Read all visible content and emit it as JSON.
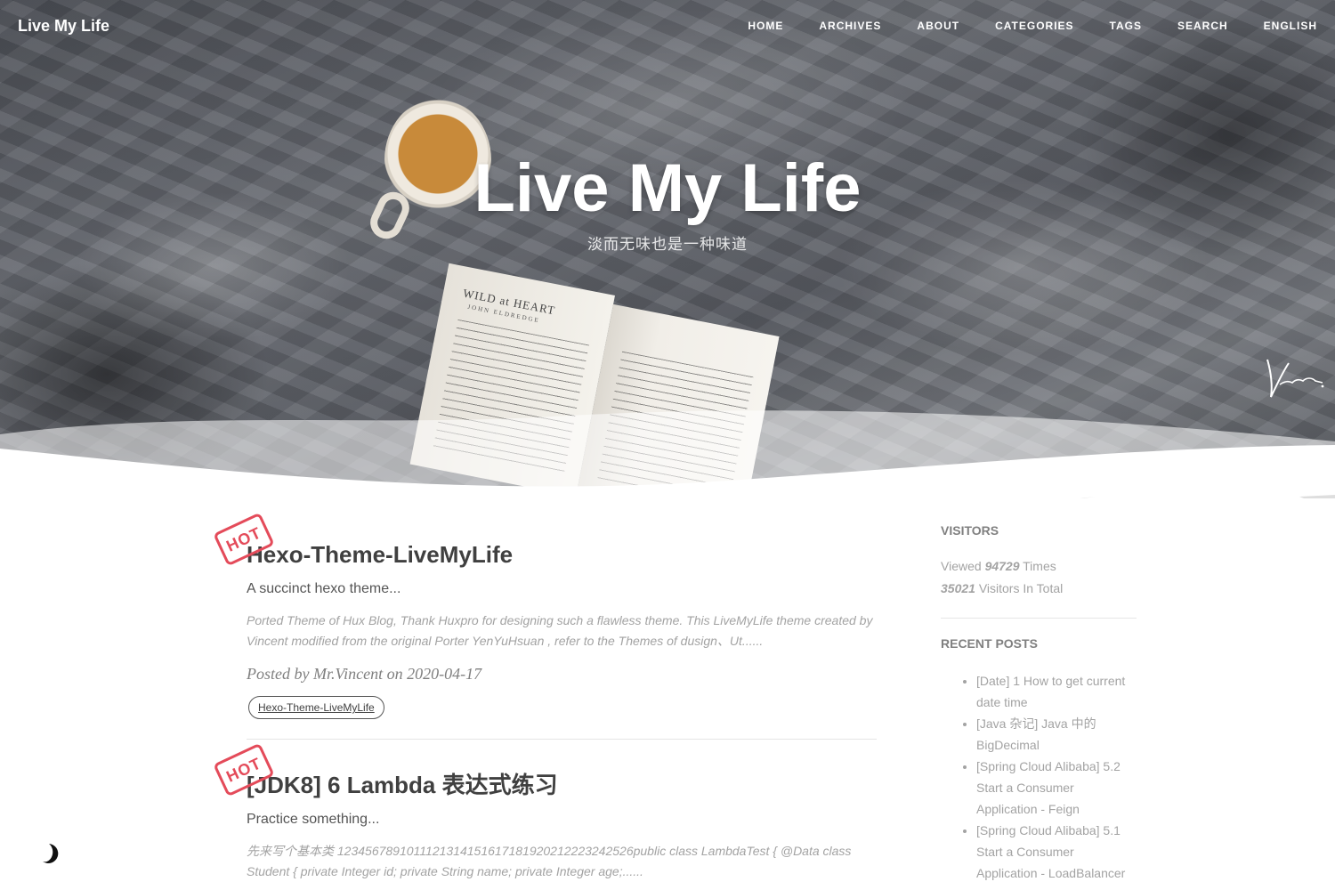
{
  "brand": {
    "title": "Live My Life"
  },
  "nav": {
    "items": [
      {
        "label": "HOME"
      },
      {
        "label": "ARCHIVES"
      },
      {
        "label": "ABOUT"
      },
      {
        "label": "CATEGORIES"
      },
      {
        "label": "TAGS"
      },
      {
        "label": "SEARCH"
      },
      {
        "label": "ENGLISH"
      }
    ]
  },
  "hero": {
    "title": "Live My Life",
    "subtitle": "淡而无味也是一种味道",
    "book_title": "WILD at HEART",
    "book_author": "JOHN ELDREDGE",
    "signature": "Vincent."
  },
  "posts": [
    {
      "badge": "HOT",
      "title": "Hexo-Theme-LiveMyLife",
      "subtitle": "A succinct hexo theme...",
      "excerpt": "Ported Theme of Hux Blog, Thank Huxpro for designing such a flawless theme. This LiveMyLife theme created by Vincent modified from the original Porter YenYuHsuan , refer to the Themes of dusign、Ut......",
      "meta": "Posted by Mr.Vincent on 2020-04-17",
      "tags": [
        "Hexo-Theme-LiveMyLife"
      ]
    },
    {
      "badge": "HOT",
      "title": "[JDK8] 6 Lambda 表达式练习",
      "subtitle": "Practice something...",
      "excerpt": "先来写个基本类 1234567891011121314151617181920212223242526public class LambdaTest { @Data class Student { private Integer id; private String name; private Integer age;......"
    }
  ],
  "sidebar": {
    "visitors_heading": "VISITORS",
    "viewed_prefix": "Viewed",
    "viewed_count": "94729",
    "viewed_suffix": "Times",
    "visitors_count": "35021",
    "visitors_suffix": "Visitors In Total",
    "recent_heading": "RECENT POSTS",
    "recent_posts": [
      "[Date] 1 How to get current date time",
      "[Java 杂记] Java 中的 BigDecimal",
      "[Spring Cloud Alibaba] 5.2 Start a Consumer Application - Feign",
      "[Spring Cloud Alibaba] 5.1 Start a Consumer Application - LoadBalancer"
    ]
  },
  "icons": {
    "theme_toggle": "moon-icon"
  },
  "colors": {
    "hot_stamp": "#e44b5a",
    "text": "#404040",
    "muted": "#a3a3a3"
  }
}
